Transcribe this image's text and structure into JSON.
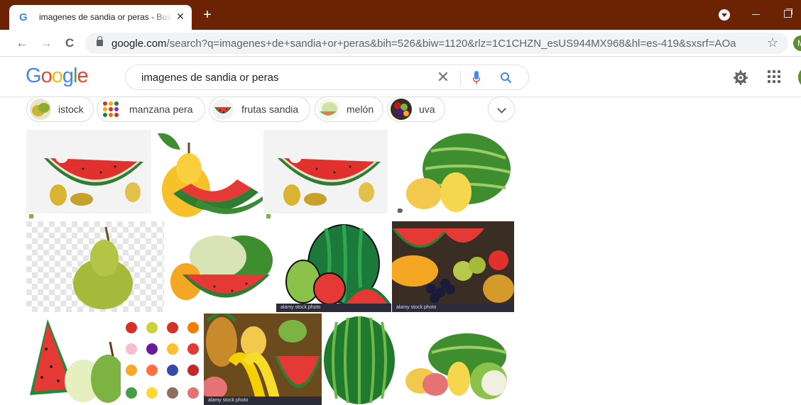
{
  "browser": {
    "tab_title": "imagenes de sandia or peras - Buscar con Google",
    "tab_favicon": "G",
    "close_glyph": "✕",
    "new_tab_glyph": "+",
    "back_glyph": "←",
    "forward_glyph": "→",
    "reload_glyph": "C",
    "url_host": "google.com",
    "url_path": "/search?q=imagenes+de+sandia+or+peras&bih=526&biw=1120&rlz=1C1CHZN_esUS944MX968&hl=es-419&sxsrf=AOaemv...",
    "star_glyph": "☆",
    "profile_initial": "M",
    "titlebar_color": "#6b2303"
  },
  "google": {
    "logo_letters": [
      "G",
      "o",
      "o",
      "g",
      "l",
      "e"
    ],
    "logo_colors": [
      "#4285f4",
      "#ea4335",
      "#fbbc05",
      "#4285f4",
      "#34a853",
      "#ea4335"
    ],
    "query": "imagenes de sandia or peras",
    "clear_glyph": "✕"
  },
  "chips": [
    {
      "label": "istock",
      "icon": "pear-thumb"
    },
    {
      "label": "manzana pera",
      "icon": "fruits-grid-thumb"
    },
    {
      "label": "frutas sandia",
      "icon": "watermelon-thumb"
    },
    {
      "label": "melón",
      "icon": "melon-thumb"
    },
    {
      "label": "uva",
      "icon": "grapes-thumb"
    }
  ],
  "images": [
    {
      "name": "watermelon-slice-pears-1",
      "caption": ""
    },
    {
      "name": "pear-watermelon-slices",
      "caption": ""
    },
    {
      "name": "watermelon-slice-pears-2",
      "caption": ""
    },
    {
      "name": "whole-watermelon-pears",
      "caption": ""
    },
    {
      "name": "single-pear",
      "caption": ""
    },
    {
      "name": "melon-watermelon-slice",
      "caption": ""
    },
    {
      "name": "cartoon-fruits",
      "caption": "alamy stock photo"
    },
    {
      "name": "fruit-market",
      "caption": "alamy stock photo"
    },
    {
      "name": "cartoon-watermelon-pear",
      "caption": ""
    },
    {
      "name": "fruit-icons-grid",
      "caption": ""
    },
    {
      "name": "tropical-fruits",
      "caption": "alamy stock photo"
    },
    {
      "name": "whole-watermelon",
      "caption": ""
    },
    {
      "name": "watermelon-fruits-cauliflower",
      "caption": ""
    }
  ]
}
